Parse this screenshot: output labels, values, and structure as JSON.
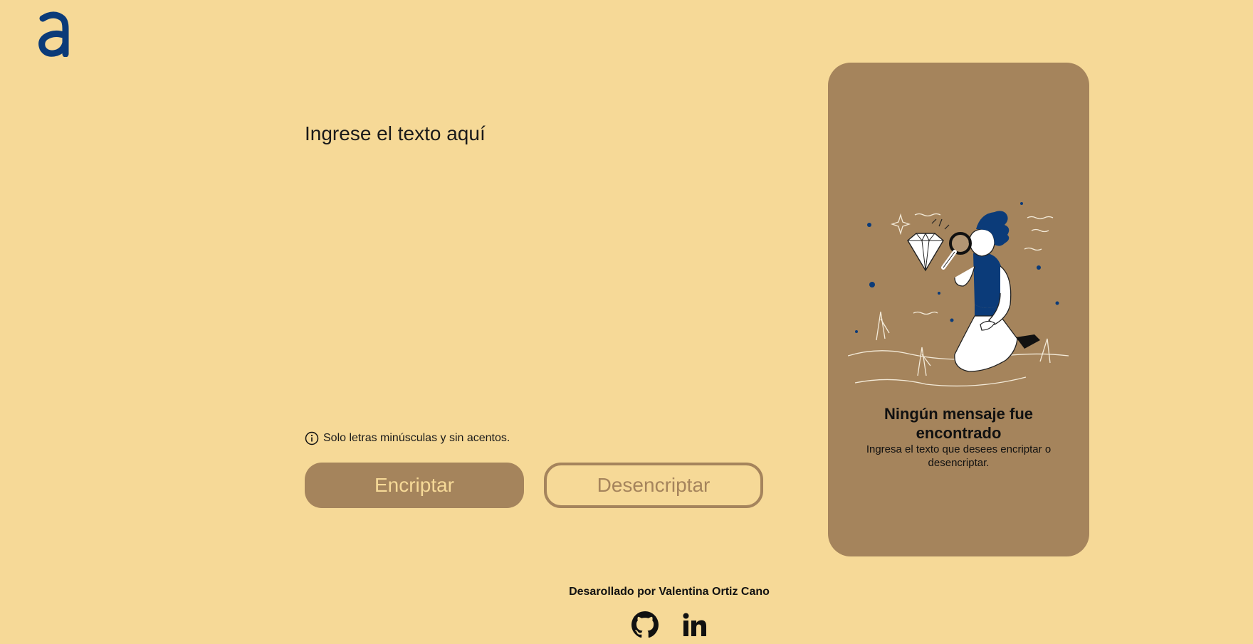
{
  "logo": {
    "letter": "a",
    "icon": "logo-a-icon",
    "color": "#0b3b79"
  },
  "input": {
    "placeholder": "Ingrese el texto aquí",
    "value": ""
  },
  "hint": {
    "icon": "info-icon",
    "text": "Solo letras minúsculas y sin acentos."
  },
  "buttons": {
    "encrypt_label": "Encriptar",
    "decrypt_label": "Desencriptar"
  },
  "output_panel": {
    "illustration": "person-with-magnifying-glass-illustration",
    "title": "Ningún mensaje fue encontrado",
    "text": "Ingresa el texto que desees encriptar o desencriptar."
  },
  "footer": {
    "credit": "Desarollado por Valentina Ortiz Cano",
    "links": [
      {
        "icon": "github-icon"
      },
      {
        "icon": "linkedin-icon"
      }
    ]
  },
  "colors": {
    "background": "#f6d997",
    "accent": "#a5845c",
    "brand": "#0b3b79",
    "text": "#1a1a1a"
  }
}
